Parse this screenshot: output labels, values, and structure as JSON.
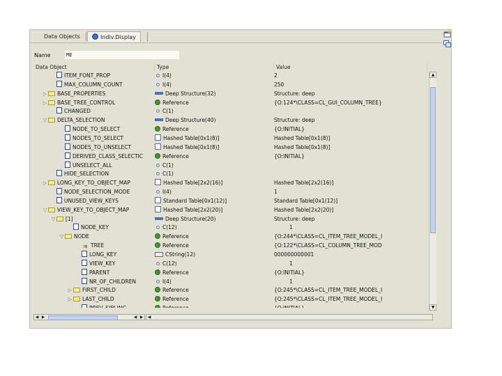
{
  "tabs": [
    {
      "label": "Data Objects",
      "active": false
    },
    {
      "label": "Indiv.Display",
      "active": true,
      "icon": "indiv-display-icon"
    }
  ],
  "name_field": {
    "label": "Name",
    "value": "ME"
  },
  "columns": {
    "data_object": "Data Object",
    "type": "Type",
    "value": "Value"
  },
  "rows": [
    {
      "name": "ITEM_FONT_PROP",
      "type": "I(4)",
      "value": "2",
      "depth": 2,
      "icon": "leaf",
      "toggle": "",
      "type_icon": "elem"
    },
    {
      "name": "MAX_COLUMN_COUNT",
      "type": "I(4)",
      "value": "250",
      "depth": 2,
      "icon": "leaf",
      "toggle": "",
      "type_icon": "elem"
    },
    {
      "name": "BASE_PROPERTIES",
      "type": "Deep Structure(32)",
      "value": "Structure: deep",
      "depth": 1,
      "icon": "folder",
      "toggle": "closed",
      "type_icon": "deep"
    },
    {
      "name": "BASE_TREE_CONTROL",
      "type": "Reference",
      "value": "{O:124*\\CLASS=CL_GUI_COLUMN_TREE}",
      "depth": 1,
      "icon": "folder",
      "toggle": "closed",
      "type_icon": "ref"
    },
    {
      "name": "CHANGED",
      "type": "C(1)",
      "value": "",
      "depth": 2,
      "icon": "leaf",
      "toggle": "",
      "type_icon": "elem"
    },
    {
      "name": "DELTA_SELECTION",
      "type": "Deep Structure(40)",
      "value": "Structure: deep",
      "depth": 1,
      "icon": "folder",
      "toggle": "open",
      "type_icon": "deep"
    },
    {
      "name": "NODE_TO_SELECT",
      "type": "Reference",
      "value": "{O:INITIAL}",
      "depth": 3,
      "icon": "leaf",
      "toggle": "",
      "type_icon": "ref"
    },
    {
      "name": "NODES_TO_SELECT",
      "type": "Hashed Table[0x1(8)]",
      "value": "Hashed Table[0x1(8)]",
      "depth": 3,
      "icon": "leaf",
      "toggle": "",
      "type_icon": "table"
    },
    {
      "name": "NODES_TO_UNSELECT",
      "type": "Hashed Table[0x1(8)]",
      "value": "Hashed Table[0x1(8)]",
      "depth": 3,
      "icon": "leaf",
      "toggle": "",
      "type_icon": "table"
    },
    {
      "name": "DERIVED_CLASS_SELECTIC",
      "type": "Reference",
      "value": "{O:INITIAL}",
      "depth": 3,
      "icon": "leaf",
      "toggle": "",
      "type_icon": "ref"
    },
    {
      "name": "UNSELECT_ALL",
      "type": "C(1)",
      "value": "",
      "depth": 3,
      "icon": "leaf",
      "toggle": "",
      "type_icon": "elem"
    },
    {
      "name": "HIDE_SELECTION",
      "type": "C(1)",
      "value": "",
      "depth": 2,
      "icon": "leaf",
      "toggle": "",
      "type_icon": "elem"
    },
    {
      "name": "LONG_KEY_TO_OBJECT_MAP",
      "type": "Hashed Table[2x2(16)]",
      "value": "Hashed Table[2x2(16)]",
      "depth": 1,
      "icon": "folder",
      "toggle": "closed",
      "type_icon": "table"
    },
    {
      "name": "NODE_SELECTION_MODE",
      "type": "I(4)",
      "value": "1",
      "depth": 2,
      "icon": "leaf",
      "toggle": "",
      "type_icon": "elem"
    },
    {
      "name": "UNUSED_VIEW_KEYS",
      "type": "Standard Table[0x1(12)]",
      "value": "Standard Table[0x1(12)]",
      "depth": 2,
      "icon": "leaf",
      "toggle": "",
      "type_icon": "table"
    },
    {
      "name": "VIEW_KEY_TO_OBJECT_MAP",
      "type": "Hashed Table[2x2(20)]",
      "value": "Hashed Table[2x2(20)]",
      "depth": 1,
      "icon": "folder",
      "toggle": "open",
      "type_icon": "table"
    },
    {
      "name": "[1]",
      "type": "Deep Structure(20)",
      "value": "Structure: deep",
      "depth": 2,
      "icon": "folder",
      "toggle": "open",
      "type_icon": "deep"
    },
    {
      "name": "NODE_KEY",
      "type": "C(12)",
      "value": "1",
      "depth": 4,
      "icon": "leaf",
      "toggle": "",
      "type_icon": "elem"
    },
    {
      "name": "NODE",
      "type": "Reference",
      "value": "{O:244*\\CLASS=CL_ITEM_TREE_MODEL_I",
      "depth": 3,
      "icon": "folder",
      "toggle": "open",
      "type_icon": "ref"
    },
    {
      "name": "TREE",
      "type": "Reference",
      "value": "{O:122*\\CLASS=CL_COLUMN_TREE_MOD",
      "depth": 5,
      "icon": "obj",
      "toggle": "",
      "type_icon": "ref"
    },
    {
      "name": "LONG_KEY",
      "type": "CString(12)",
      "value": "000000000001",
      "depth": 5,
      "icon": "leaf",
      "toggle": "",
      "type_icon": "cstr"
    },
    {
      "name": "VIEW_KEY",
      "type": "C(12)",
      "value": "1",
      "depth": 5,
      "icon": "leaf",
      "toggle": "",
      "type_icon": "elem"
    },
    {
      "name": "PARENT",
      "type": "Reference",
      "value": "{O:INITIAL}",
      "depth": 5,
      "icon": "leaf",
      "toggle": "",
      "type_icon": "ref"
    },
    {
      "name": "NR_OF_CHILDREN",
      "type": "I(4)",
      "value": "1",
      "depth": 5,
      "icon": "leaf",
      "toggle": "",
      "type_icon": "elem"
    },
    {
      "name": "FIRST_CHILD",
      "type": "Reference",
      "value": "{O:245*\\CLASS=CL_ITEM_TREE_MODEL_I",
      "depth": 4,
      "icon": "folder",
      "toggle": "closed",
      "type_icon": "ref"
    },
    {
      "name": "LAST_CHILD",
      "type": "Reference",
      "value": "{O:245*\\CLASS=CL_ITEM_TREE_MODEL_I",
      "depth": 4,
      "icon": "folder",
      "toggle": "closed",
      "type_icon": "ref"
    },
    {
      "name": "PREV_SIBLING",
      "type": "Reference",
      "value": "{O:INITIAL}",
      "depth": 5,
      "icon": "leaf",
      "toggle": "",
      "type_icon": "ref"
    }
  ]
}
